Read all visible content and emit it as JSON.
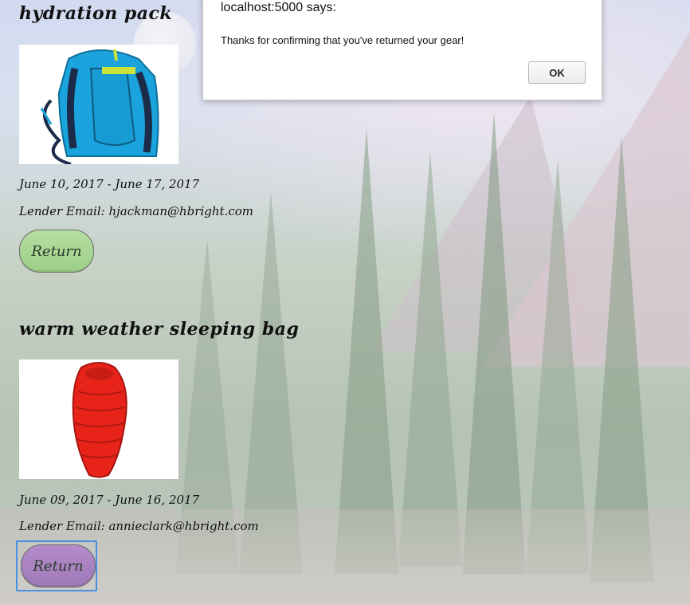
{
  "dialog": {
    "title": "localhost:5000 says:",
    "message": "Thanks for confirming that you've returned your gear!",
    "ok_label": "OK"
  },
  "items": [
    {
      "name": "hydration pack",
      "dates": "June 10, 2017 - June 17, 2017",
      "lender": "Lender Email: hjackman@hbright.com",
      "button_label": "Return"
    },
    {
      "name": "warm weather sleeping bag",
      "dates": "June 09, 2017 - June 16, 2017",
      "lender": "Lender Email: annieclark@hbright.com",
      "button_label": "Return"
    }
  ],
  "colors": {
    "return_button_default": "#9dcf88",
    "return_button_active": "#a07ab8",
    "focus_ring": "#4a90e2",
    "pack_color": "#1aa3dc",
    "sleeping_bag_color": "#e8241a"
  }
}
